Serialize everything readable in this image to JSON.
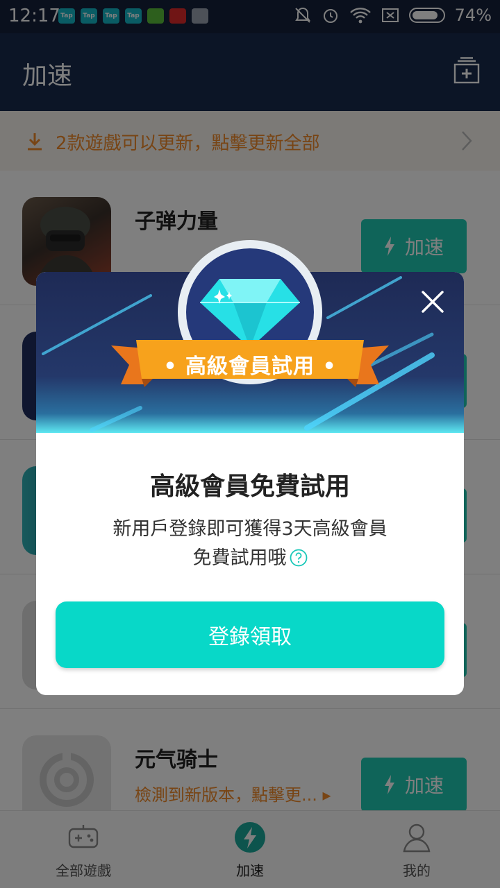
{
  "status_bar": {
    "time": "12:17",
    "battery": "74%",
    "notif_icons": [
      {
        "name": "taptap-icon",
        "label": "Tap",
        "color": "#14b9c8"
      },
      {
        "name": "taptap-icon",
        "label": "Tap",
        "color": "#14b9c8"
      },
      {
        "name": "taptap-icon",
        "label": "Tap",
        "color": "#14b9c8"
      },
      {
        "name": "taptap-icon",
        "label": "Tap",
        "color": "#14b9c8"
      },
      {
        "name": "game-app-icon",
        "label": "",
        "color": "#5bbf3a"
      },
      {
        "name": "netease-music-icon",
        "label": "",
        "color": "#e02a2a"
      },
      {
        "name": "notes-app-icon",
        "label": "",
        "color": "#9aa3b0"
      }
    ]
  },
  "header": {
    "title": "加速"
  },
  "update_banner": {
    "text": "2款遊戲可以更新，點擊更新全部"
  },
  "games": [
    {
      "name": "子弹力量",
      "subtitle": "",
      "button": "加速"
    },
    {
      "name": "",
      "subtitle": "",
      "button": ""
    },
    {
      "name": "",
      "subtitle": "",
      "button": ""
    },
    {
      "name": "",
      "subtitle": "",
      "button": ""
    },
    {
      "name": "元气骑士",
      "subtitle": "檢測到新版本，點擊更... ▸",
      "button": "加速"
    }
  ],
  "bottom_nav": [
    {
      "label": "全部遊戲",
      "icon": "gamepad-icon"
    },
    {
      "label": "加速",
      "icon": "lightning-icon"
    },
    {
      "label": "我的",
      "icon": "person-icon"
    }
  ],
  "dialog": {
    "badge_text": "• 高級會員試用 •",
    "title": "高級會員免費試用",
    "desc_line1": "新用戶登錄即可獲得3天高級會員",
    "desc_line2": "免費試用哦",
    "button": "登錄領取"
  },
  "colors": {
    "accent": "#08d8c8",
    "orange": "#f08a2b",
    "header_bg": "#192b4c"
  }
}
